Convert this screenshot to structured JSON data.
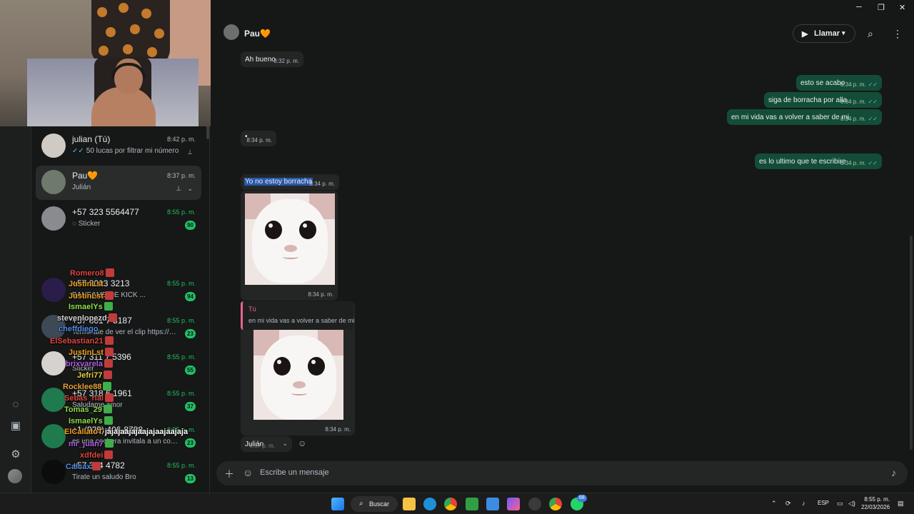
{
  "contact": {
    "name": "Pau🧡",
    "call_label": "Llamar"
  },
  "chats": [
    {
      "name": "julian (Tú)",
      "preview": "50 lucas por filtrar mi número",
      "time": "8:42 p. m."
    },
    {
      "name": "Pau🧡",
      "preview": "Julián",
      "time": "8:37 p. m."
    },
    {
      "name": "+57 323 5564477",
      "preview": "Sticker",
      "time": "8:55 p. m.",
      "badge": "90"
    },
    {
      "name": "+57 3013 3213",
      "preview": "BANEAME DE KICK ...",
      "time": "8:55 p. m.",
      "badge": "94"
    },
    {
      "name": "+57 301 7 5187",
      "preview": "Terminate de ver el clip https://ww...",
      "time": "8:55 p. m.",
      "badge": "23"
    },
    {
      "name": "+57 311 7 5396",
      "preview": "Sticker",
      "time": "8:55 p. m.",
      "badge": "55"
    },
    {
      "name": "+57 318 6 1961",
      "preview": "Saludame amor",
      "time": "8:55 p. m.",
      "badge": "37"
    },
    {
      "name": "+1 (929) 406-8798",
      "preview": "es una cochera invitala a un cocin...",
      "time": "8:55 p. m.",
      "badge": "23"
    },
    {
      "name": "+57 324 4782",
      "preview": "Tirate un saludo Bro",
      "time": "8:55 p. m.",
      "badge": "13"
    }
  ],
  "twitch_chat": [
    {
      "user": "Romero8",
      "text": "",
      "color": "#e0463f"
    },
    {
      "user": "JustinLst",
      "text": "",
      "color": "#f0a21a"
    },
    {
      "user": "JustinLst",
      "text": "",
      "color": "#f0a21a"
    },
    {
      "user": "IsmaelYs",
      "text": "",
      "color": "#8de04a"
    },
    {
      "user": "stevenlopezd",
      "text": "",
      "color": "#d2d2d2"
    },
    {
      "user": "cheffdiego",
      "text": "",
      "color": "#4f8de8"
    },
    {
      "user": "ElSebastian21",
      "text": "",
      "color": "#e0463f"
    },
    {
      "user": "JustinLst",
      "text": "",
      "color": "#f0a21a"
    },
    {
      "user": "brixvarela",
      "text": "",
      "color": "#b15ee6"
    },
    {
      "user": "Jefri77",
      "text": "",
      "color": "#e3d03a"
    },
    {
      "user": "Rocklee88",
      "text": "",
      "color": "#e8a23a"
    },
    {
      "user": "Sebas_rial",
      "text": "",
      "color": "#e0463f"
    },
    {
      "user": "Tomas_29",
      "text": "",
      "color": "#8de04a"
    },
    {
      "user": "IsmaelYs",
      "text": "",
      "color": "#8de04a"
    },
    {
      "user": "ElCallatoT",
      "text": "jajajaajajaajajaajaajaja",
      "color": "#f0a21a"
    },
    {
      "user": "mr_juan7",
      "text": "",
      "color": "#b15ee6"
    },
    {
      "user": "xdfdei",
      "text": "",
      "color": "#e0463f"
    },
    {
      "user": "Calcax",
      "text": "",
      "color": "#4f8de8"
    }
  ],
  "messages": {
    "m1": {
      "text": "Ah bueno",
      "time": "8:32 p. m."
    },
    "m2": {
      "text": "esto se acabo",
      "time": "8:34 p. m."
    },
    "m3": {
      "text": "siga de borracha por alla",
      "time": "8:34 p. m."
    },
    "m4": {
      "text": "en mi vida vas a volver a saber de mi",
      "time": "8:34 p. m."
    },
    "m5": {
      "text": "•",
      "time": "8:34 p. m."
    },
    "m6": {
      "text": "es lo ultimo que te escribire",
      "time": "8:34 p. m."
    },
    "m7": {
      "text": "Yo no estoy borracha",
      "time": "8:34 p. m."
    },
    "m8": {
      "time": "8:34 p. m."
    },
    "m9": {
      "quote_author": "Tú",
      "quote_text": "en mi vida vas a volver a saber de mi",
      "time": "8:34 p. m."
    },
    "m10": {
      "text": "Julián",
      "time": "8:37 p. m."
    }
  },
  "composer": {
    "placeholder": "Escribe un mensaje"
  },
  "taskbar": {
    "search_label": "Buscar",
    "lang": "ESP",
    "time": "8:55 p. m.",
    "date": "22/03/2026",
    "wa_badge": "68"
  }
}
